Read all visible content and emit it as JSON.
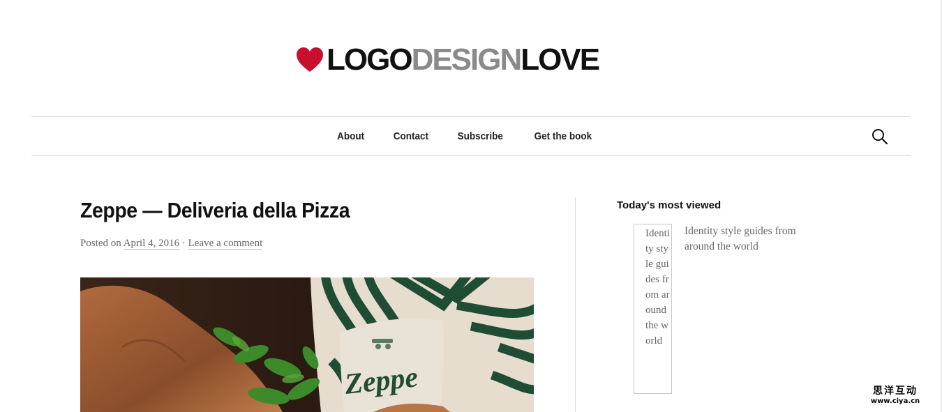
{
  "site": {
    "logo": {
      "part1": "LOGO",
      "part2": "DESIGN",
      "part3": "LOVE",
      "heart_color": "#c8102e"
    }
  },
  "nav": {
    "items": [
      {
        "label": "About"
      },
      {
        "label": "Contact"
      },
      {
        "label": "Subscribe"
      },
      {
        "label": "Get the book"
      }
    ],
    "search_icon": "search-icon"
  },
  "post": {
    "title": "Zeppe — Deliveria della Pizza",
    "meta_prefix": "Posted on",
    "date": "April 4, 2016",
    "separator": " · ",
    "comment_link": "Leave a comment",
    "image_brand_text": "Zeppe"
  },
  "sidebar": {
    "widget_title": "Today's most viewed",
    "items": [
      {
        "thumb_alt": "Identity style guides from around the world",
        "title": "Identity style guides from around the world"
      }
    ]
  },
  "watermark": {
    "line1": "思洋互动",
    "line2": "www.ciya.cn"
  },
  "colors": {
    "text": "#222222",
    "muted": "#666666",
    "accent": "#c8102e",
    "pattern_green": "#1f4d33"
  }
}
